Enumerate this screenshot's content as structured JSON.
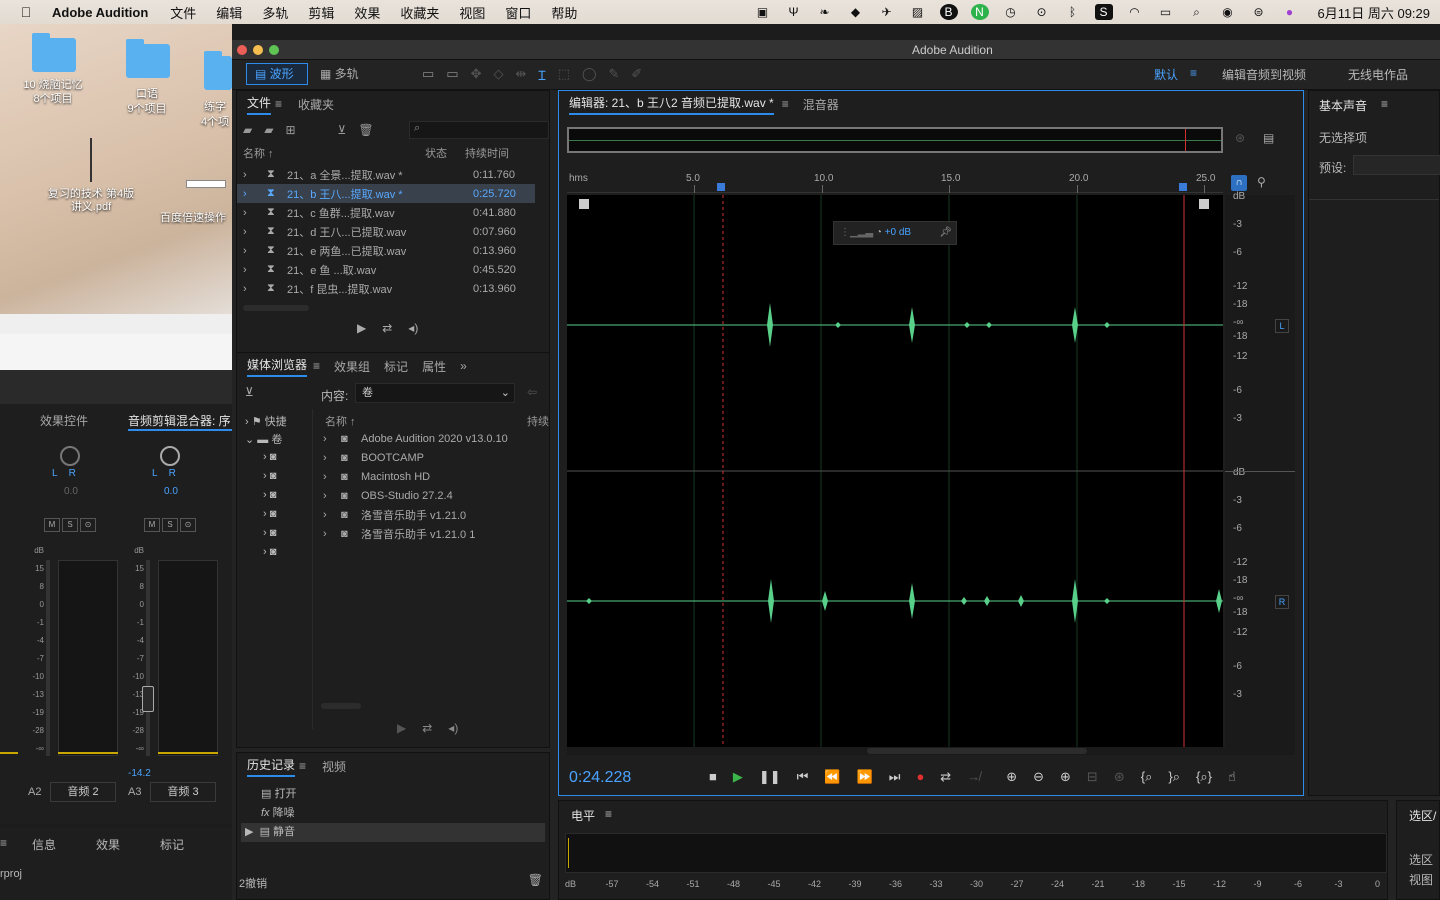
{
  "menubar": {
    "app_name": "Adobe Audition",
    "items": [
      "文件",
      "编辑",
      "多轨",
      "剪辑",
      "效果",
      "收藏夹",
      "视图",
      "窗口",
      "帮助"
    ],
    "clock": "6月11日 周六  09:29"
  },
  "desktop": {
    "items": [
      {
        "name": "10 烧脑记忆",
        "sub": "8个项目"
      },
      {
        "name": "口语",
        "sub": "9个项目"
      },
      {
        "name": "练字",
        "sub": "4个项"
      },
      {
        "name": "复习的技术 第4版\n讲义.pdf",
        "sub": ""
      },
      {
        "name": "百度倍速操作",
        "sub": ""
      }
    ]
  },
  "window": {
    "title": "Adobe Audition",
    "view_waveform": "波形",
    "view_multitrack": "多轨",
    "workspace_default": "默认",
    "workspace_edit_video": "编辑音频到视频",
    "workspace_radio": "无线电作品"
  },
  "files_panel": {
    "tab_files": "文件",
    "tab_favorites": "收藏夹",
    "col_name": "名称 ↑",
    "col_status": "状态",
    "col_duration": "持续时间",
    "files": [
      {
        "name": "21、a 全景...提取.wav *",
        "dur": "0:11.760",
        "selected": false
      },
      {
        "name": "21、b 王八...提取.wav *",
        "dur": "0:25.720",
        "selected": true
      },
      {
        "name": "21、c 鱼群...提取.wav",
        "dur": "0:41.880",
        "selected": false
      },
      {
        "name": "21、d 王八...已提取.wav",
        "dur": "0:07.960",
        "selected": false
      },
      {
        "name": "21、e 两鱼...已提取.wav",
        "dur": "0:13.960",
        "selected": false
      },
      {
        "name": "21、e 鱼 ...取.wav",
        "dur": "0:45.520",
        "selected": false
      },
      {
        "name": "21、f 昆虫...提取.wav",
        "dur": "0:13.960",
        "selected": false
      }
    ]
  },
  "media_panel": {
    "tabs": [
      "媒体浏览器",
      "效果组",
      "标记",
      "属性"
    ],
    "content_label": "内容:",
    "content_value": "卷",
    "col_name": "名称 ↑",
    "col_duration": "持续",
    "tree": [
      "快捷",
      "卷"
    ],
    "volumes": [
      "Adobe Audition 2020 v13.0.10",
      "BOOTCAMP",
      "Macintosh HD",
      "OBS-Studio 27.2.4",
      "洛雪音乐助手 v1.21.0",
      "洛雪音乐助手 v1.21.0 1"
    ]
  },
  "history_panel": {
    "tab_history": "历史记录",
    "tab_video": "视频",
    "items": [
      "打开",
      "降噪",
      "静音"
    ],
    "undo_count": "2撤销"
  },
  "mixer_left": {
    "tab_effects": "效果控件",
    "tab_mixer": "音频剪辑混合器: 序",
    "pan_a2": "0.0",
    "pan_a3": "0.0",
    "level_a3": "-14.2",
    "track_a2_id": "A2",
    "track_a2_name": "音频 2",
    "track_a3_id": "A3",
    "track_a3_name": "音频 3",
    "bottom_tabs": [
      "信息",
      "效果",
      "标记"
    ],
    "project": "rproj",
    "db_scale": [
      "dB",
      "15",
      "8",
      "0",
      "-1",
      "-4",
      "-7",
      "-10",
      "-13",
      "-19",
      "-28",
      "-∞"
    ]
  },
  "editor": {
    "tab_editor": "编辑器: 21、b 王八2 音频已提取.wav *",
    "tab_mixer": "混音器",
    "ruler_unit": "hms",
    "ruler_ticks": [
      "5.0",
      "10.0",
      "15.0",
      "20.0",
      "25.0"
    ],
    "gain_value": "+0 dB",
    "db_labels_top": [
      "dB",
      "-3",
      "-6",
      "-12",
      "-18",
      "-∞",
      "-18",
      "-12",
      "-6",
      "-3"
    ],
    "db_labels_bottom": [
      "dB",
      "-3",
      "-6",
      "-12",
      "-18",
      "-∞",
      "-18",
      "-12",
      "-6",
      "-3"
    ],
    "channel_left": "L",
    "channel_right": "R",
    "time": "0:24.228"
  },
  "essential_sound": {
    "title": "基本声音",
    "no_selection": "无选择项",
    "preset_label": "预设:"
  },
  "levels": {
    "title": "电平",
    "scale": [
      "dB",
      "-57",
      "-54",
      "-51",
      "-48",
      "-45",
      "-42",
      "-39",
      "-36",
      "-33",
      "-30",
      "-27",
      "-24",
      "-21",
      "-18",
      "-15",
      "-12",
      "-9",
      "-6",
      "-3",
      "0"
    ]
  },
  "selection_panel": {
    "title": "选区/",
    "sel": "选区",
    "view": "视图"
  },
  "colors": {
    "accent": "#2d8ceb",
    "wave": "#59d08a",
    "playhead": "#d33030"
  }
}
